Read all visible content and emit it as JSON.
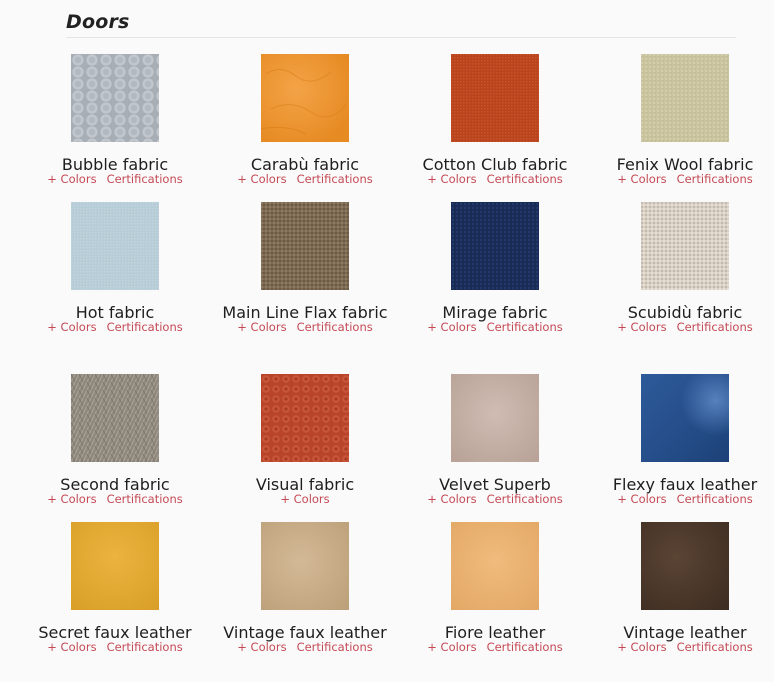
{
  "section": {
    "title": "Doors"
  },
  "items": [
    {
      "name": "Bubble fabric",
      "colors": "+ Colors",
      "certs": "Certifications",
      "swatch": "bubble"
    },
    {
      "name": "Carabù fabric",
      "colors": "+ Colors",
      "certs": "Certifications",
      "swatch": "carabu"
    },
    {
      "name": "Cotton Club fabric",
      "colors": "+ Colors",
      "certs": "Certifications",
      "swatch": "cotton"
    },
    {
      "name": "Fenix Wool fabric",
      "colors": "+ Colors",
      "certs": "Certifications",
      "swatch": "fenix"
    },
    {
      "name": "Hot fabric",
      "colors": "+ Colors",
      "certs": "Certifications",
      "swatch": "hot"
    },
    {
      "name": "Main Line Flax fabric",
      "colors": "+ Colors",
      "certs": "Certifications",
      "swatch": "mainline"
    },
    {
      "name": "Mirage fabric",
      "colors": "+ Colors",
      "certs": "Certifications",
      "swatch": "mirage"
    },
    {
      "name": "Scubidù fabric",
      "colors": "+ Colors",
      "certs": "Certifications",
      "swatch": "scubidu"
    },
    {
      "name": "Second fabric",
      "colors": "+ Colors",
      "certs": "Certifications",
      "swatch": "second"
    },
    {
      "name": "Visual fabric",
      "colors": "+ Colors",
      "certs": "",
      "swatch": "visual"
    },
    {
      "name": "Velvet Superb",
      "colors": "+ Colors",
      "certs": "Certifications",
      "swatch": "velvet"
    },
    {
      "name": "Flexy faux leather",
      "colors": "+ Colors",
      "certs": "Certifications",
      "swatch": "flexy"
    },
    {
      "name": "Secret faux leather",
      "colors": "+ Colors",
      "certs": "Certifications",
      "swatch": "secret"
    },
    {
      "name": "Vintage faux leather",
      "colors": "+ Colors",
      "certs": "Certifications",
      "swatch": "vintagefaux"
    },
    {
      "name": "Fiore leather",
      "colors": "+ Colors",
      "certs": "Certifications",
      "swatch": "fiore"
    },
    {
      "name": "Vintage leather",
      "colors": "+ Colors",
      "certs": "Certifications",
      "swatch": "vintage"
    }
  ],
  "colors": {
    "link": "#c44a55",
    "text": "#1e1e1e"
  }
}
